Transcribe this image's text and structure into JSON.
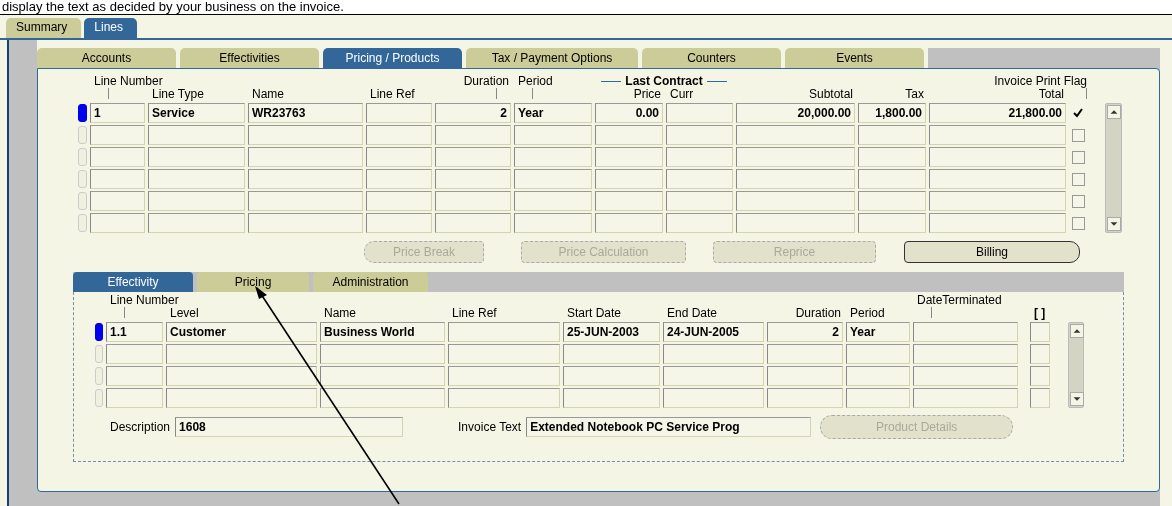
{
  "caption": "display the text as decided by your business on the invoice.",
  "window_tabs": [
    {
      "label": "Summary",
      "selected": false
    },
    {
      "label": "Lines",
      "selected": true
    }
  ],
  "sub_tabs": [
    {
      "label": "Accounts",
      "selected": false
    },
    {
      "label": "Effectivities",
      "selected": false
    },
    {
      "label": "Pricing / Products",
      "selected": true
    },
    {
      "label": "Tax / Payment Options",
      "selected": false
    },
    {
      "label": "Counters",
      "selected": false
    },
    {
      "label": "Events",
      "selected": false
    }
  ],
  "lines_table": {
    "group_label": "Last Contract",
    "columns": [
      "Line Number",
      "Line Type",
      "Name",
      "Line Ref",
      "Duration",
      "Period",
      "Price",
      "Curr",
      "Subtotal",
      "Tax",
      "Total"
    ],
    "flag_label": "Invoice Print Flag",
    "rows": [
      {
        "selected": true,
        "print_flag": true,
        "line_number": "1",
        "line_type": "Service",
        "name": "WR23763",
        "duration": "2",
        "period": "Year",
        "price": "0.00",
        "subtotal": "20,000.00",
        "tax": "1,800.00",
        "total": "21,800.00"
      },
      {
        "selected": false,
        "print_flag": false
      },
      {
        "selected": false,
        "print_flag": false
      },
      {
        "selected": false,
        "print_flag": false
      },
      {
        "selected": false,
        "print_flag": false
      },
      {
        "selected": false,
        "print_flag": false
      }
    ]
  },
  "buttons": [
    {
      "label": "Price Break",
      "disabled": true
    },
    {
      "label": "Price Calculation",
      "disabled": true
    },
    {
      "label": "Reprice",
      "disabled": true
    },
    {
      "label": "Billing",
      "disabled": false
    }
  ],
  "detail_tabs": [
    {
      "label": "Effectivity",
      "selected": true
    },
    {
      "label": "Pricing",
      "selected": false
    },
    {
      "label": "Administration",
      "selected": false
    }
  ],
  "effectivity_table": {
    "columns": [
      "Line Number",
      "Level",
      "Name",
      "Line Ref",
      "Start Date",
      "End Date",
      "Duration",
      "Period",
      "DateTerminated"
    ],
    "flag_label": "[ ]",
    "rows": [
      {
        "selected": true,
        "line_number": "1.1",
        "level": "Customer",
        "name": "Business World",
        "start_date": "25-JUN-2003",
        "end_date": "24-JUN-2005",
        "duration": "2",
        "period": "Year"
      },
      {
        "selected": false
      },
      {
        "selected": false
      },
      {
        "selected": false
      }
    ]
  },
  "description": {
    "label": "Description",
    "value": "1608"
  },
  "invoice_text": {
    "label": "Invoice Text",
    "value": "Extended Notebook PC Service Prog"
  },
  "product_details": {
    "label": "Product Details",
    "disabled": true
  }
}
